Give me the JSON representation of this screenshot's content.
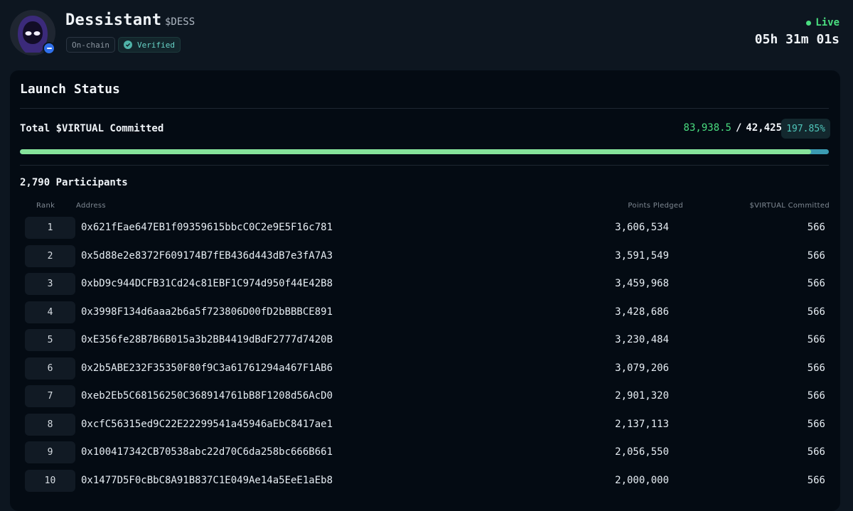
{
  "token": {
    "name": "Dessistant",
    "ticker": "$DESS",
    "tags": [
      "On-chain",
      "Verified"
    ]
  },
  "status": {
    "live_label": "Live",
    "countdown": "05h 31m 01s"
  },
  "launch": {
    "title": "Launch Status",
    "committed_label": "Total $VIRTUAL Committed",
    "committed_current": "83,938.5",
    "committed_separator": "/",
    "committed_target": "42,425",
    "percent": "197.85%",
    "progress_fill_fraction": 0.978,
    "participants": "2,790 Participants"
  },
  "table": {
    "headers": {
      "rank": "Rank",
      "address": "Address",
      "points": "Points Pledged",
      "committed": "$VIRTUAL Committed"
    },
    "rows": [
      {
        "rank": "1",
        "address": "0x621fEae647EB1f09359615bbcC0C2e9E5F16c781",
        "points": "3,606,534",
        "committed": "566"
      },
      {
        "rank": "2",
        "address": "0x5d88e2e8372F609174B7fEB436d443dB7e3fA7A3",
        "points": "3,591,549",
        "committed": "566"
      },
      {
        "rank": "3",
        "address": "0xbD9c944DCFB31Cd24c81EBF1C974d950f44E42B8",
        "points": "3,459,968",
        "committed": "566"
      },
      {
        "rank": "4",
        "address": "0x3998F134d6aaa2b6a5f723806D00fD2bBBBCE891",
        "points": "3,428,686",
        "committed": "566"
      },
      {
        "rank": "5",
        "address": "0xE356fe28B7B6B015a3b2BB4419dBdF2777d7420B",
        "points": "3,230,484",
        "committed": "566"
      },
      {
        "rank": "6",
        "address": "0x2b5ABE232F35350F80f9C3a61761294a467F1AB6",
        "points": "3,079,206",
        "committed": "566"
      },
      {
        "rank": "7",
        "address": "0xeb2Eb5C68156250C368914761bB8F1208d56AcD0",
        "points": "2,901,320",
        "committed": "566"
      },
      {
        "rank": "8",
        "address": "0xcfC56315ed9C22E22299541a45946aEbC8417ae1",
        "points": "2,137,113",
        "committed": "566"
      },
      {
        "rank": "9",
        "address": "0x100417342CB70538abc22d70C6da258bc666B661",
        "points": "2,056,550",
        "committed": "566"
      },
      {
        "rank": "10",
        "address": "0x1477D5F0cBbC8A91B837C1E049Ae14a5EeE1aEb8",
        "points": "2,000,000",
        "committed": "566"
      }
    ]
  }
}
